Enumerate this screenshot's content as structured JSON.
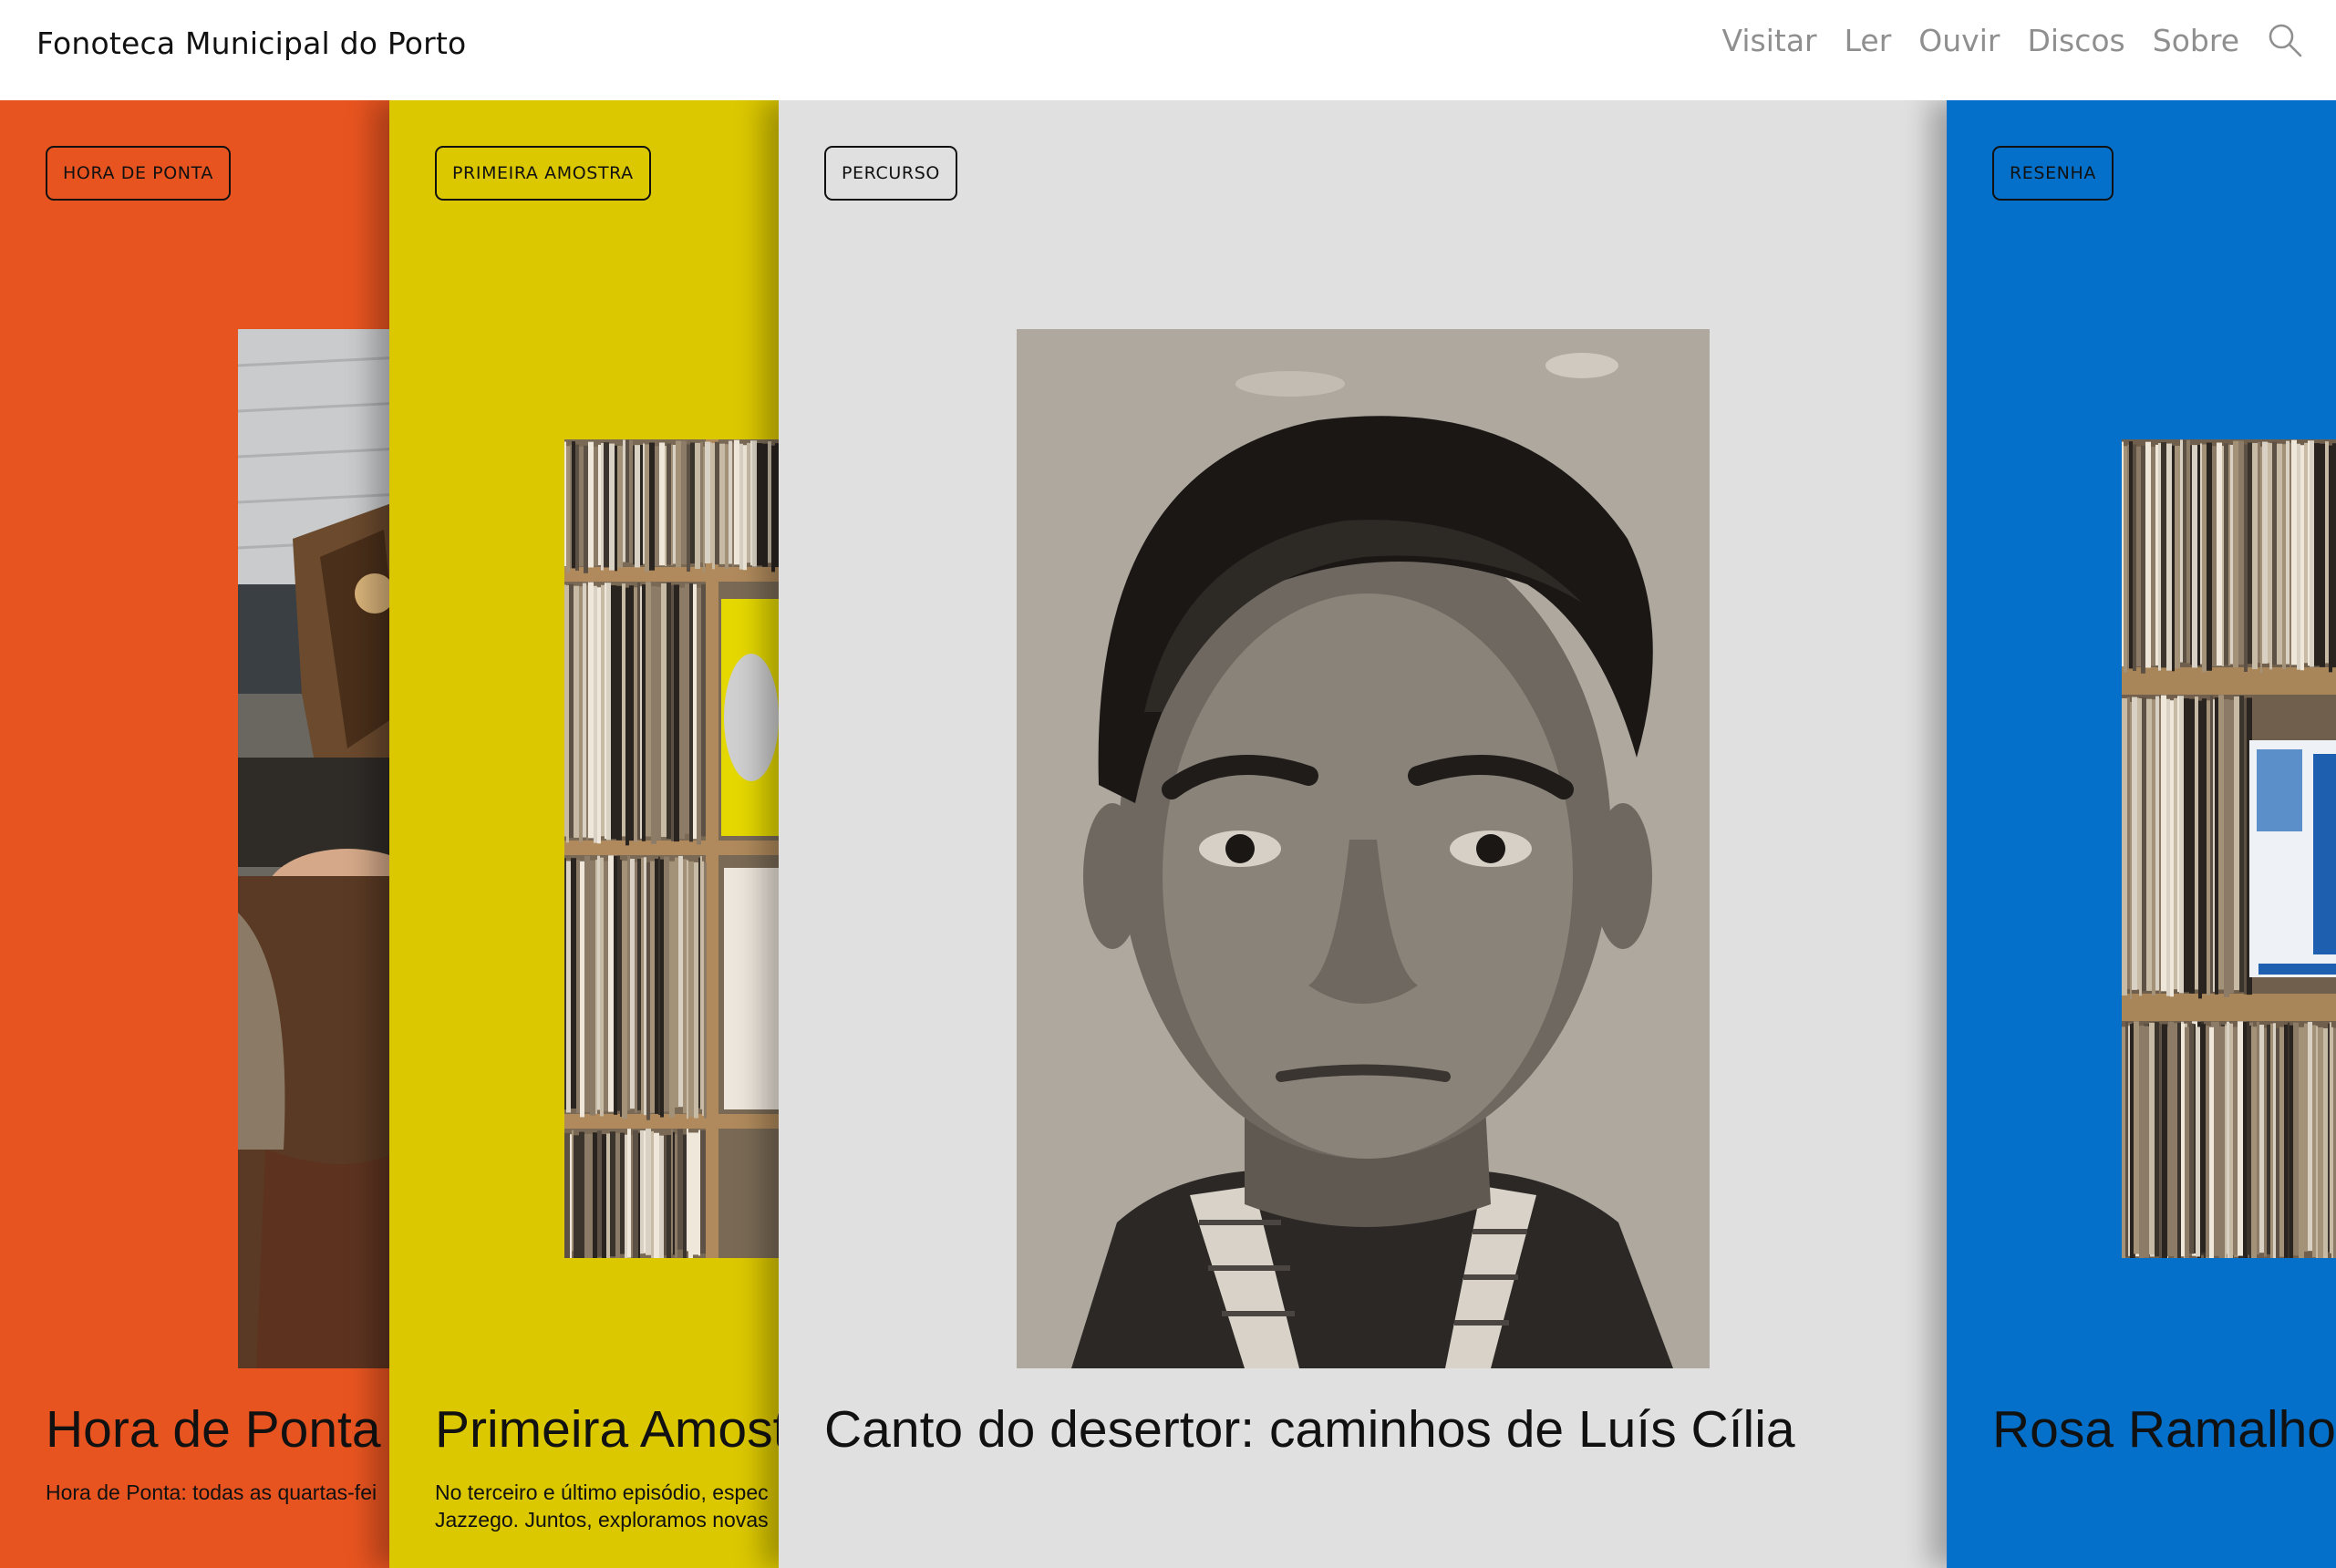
{
  "header": {
    "brand": "Fonoteca Municipal do Porto",
    "nav": [
      "Visitar",
      "Ler",
      "Ouvir",
      "Discos",
      "Sobre"
    ],
    "search_icon": "search-icon"
  },
  "cards": [
    {
      "tag": "HORA DE PONTA",
      "title": "Hora de Ponta |",
      "description": "Hora de Ponta: todas as quartas-fei",
      "color": "#e85420",
      "image": "person-holding-record-photo"
    },
    {
      "tag": "PRIMEIRA AMOSTRA",
      "title": "Primeira Amostra",
      "description_lines": [
        "No terceiro e último episódio, espec",
        "Jazzego. Juntos, exploramos novas"
      ],
      "color": "#dcc800",
      "image": "record-shelves-photo"
    },
    {
      "tag": "PERCURSO",
      "title": "Canto do desertor: caminhos de Luís Cília",
      "color": "#e0e0e0",
      "image": "portrait-photo"
    },
    {
      "tag": "RESENHA",
      "title": "Rosa Ramalho e",
      "color": "#0570c9",
      "image": "record-shelves-photo"
    }
  ]
}
